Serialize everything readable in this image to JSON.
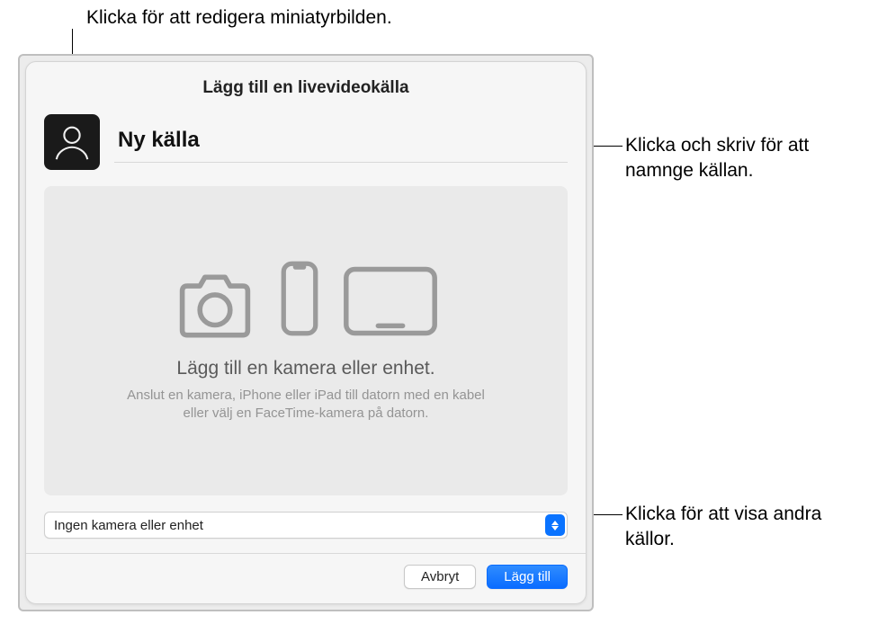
{
  "callouts": {
    "thumb": "Klicka för att redigera miniatyrbilden.",
    "name": "Klicka och skriv för att namnge källan.",
    "dropdown": "Klicka för att visa andra källor."
  },
  "dialog": {
    "title": "Lägg till en livevideokälla",
    "sourceName": "Ny källa",
    "preview": {
      "heading": "Lägg till en kamera eller enhet.",
      "sub": "Anslut en kamera, iPhone eller iPad till datorn med en kabel eller välj en FaceTime-kamera på datorn."
    },
    "dropdown": {
      "selected": "Ingen kamera eller enhet"
    },
    "buttons": {
      "cancel": "Avbryt",
      "add": "Lägg till"
    }
  }
}
